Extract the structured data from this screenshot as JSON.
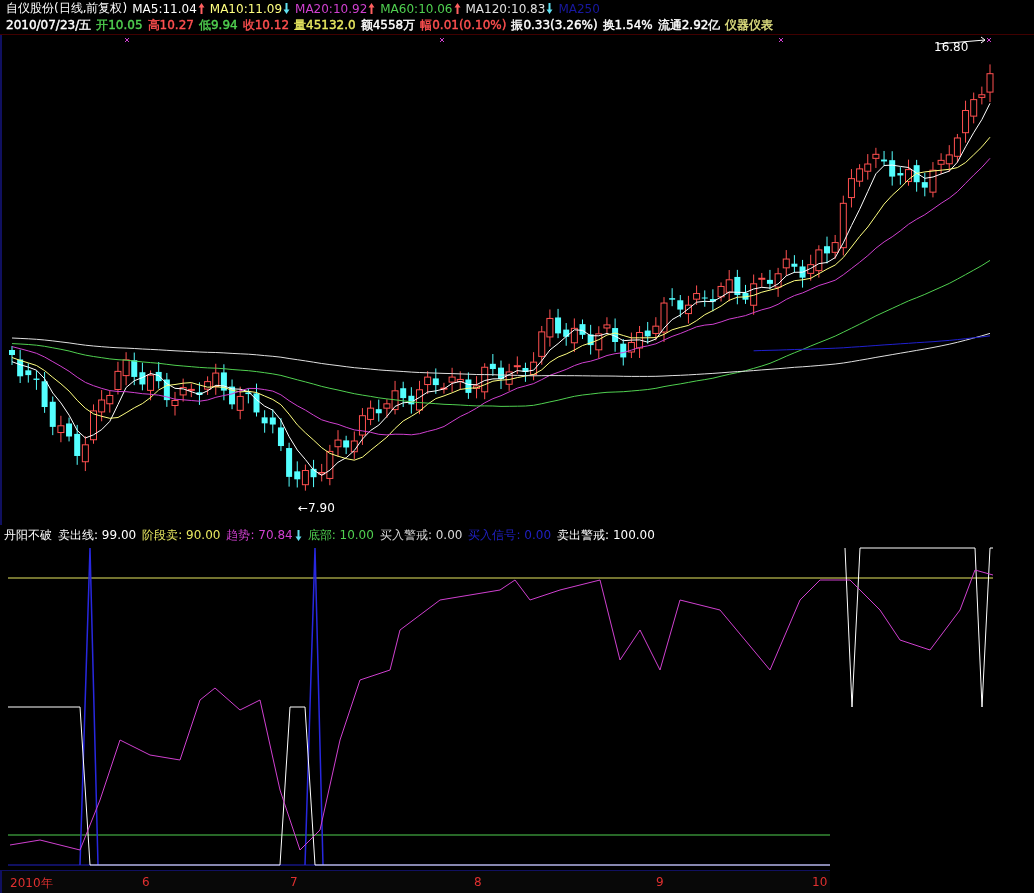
{
  "header": {
    "title": "自仪股份(日线,前复权)",
    "moving_averages": [
      {
        "label": "MA5:",
        "value": "11.04",
        "rising": true,
        "color": "#ffffff"
      },
      {
        "label": "MA10:",
        "value": "11.09",
        "rising": false,
        "color": "#ffff80"
      },
      {
        "label": "MA20:",
        "value": "10.92",
        "rising": true,
        "color": "#d040d0"
      },
      {
        "label": "MA60:",
        "value": "10.06",
        "rising": true,
        "color": "#50d050"
      },
      {
        "label": "MA120:",
        "value": "10.83",
        "rising": false,
        "color": "#e0e0e0"
      },
      {
        "label": "MA250",
        "color": "#1818a0"
      }
    ],
    "quote": [
      {
        "text": "2010/07/23/五",
        "color": "#ffffff"
      },
      {
        "text": "开10.05",
        "color": "#50d050"
      },
      {
        "text": "高10.27",
        "color": "#ff5050"
      },
      {
        "text": "低9.94",
        "color": "#50d050"
      },
      {
        "text": "收10.12",
        "color": "#ff5050"
      },
      {
        "text": "量45132.0",
        "color": "#e8e860"
      },
      {
        "text": "额4558万",
        "color": "#ffffff"
      },
      {
        "text": "幅0.01(0.10%)",
        "color": "#ff5050"
      },
      {
        "text": "振0.33(3.26%)",
        "color": "#ffffff"
      },
      {
        "text": "换1.54%",
        "color": "#ffffff"
      },
      {
        "text": "流通2.92亿",
        "color": "#ffffff"
      },
      {
        "text": "仪器仪表",
        "color": "#e0e080"
      }
    ]
  },
  "price_marks": {
    "high": "16.80",
    "low": "←7.90"
  },
  "indicator": {
    "name": "丹阳不破",
    "items": [
      {
        "label": "卖出线:",
        "value": "99.00",
        "color": "#ffffff"
      },
      {
        "label": "阶段卖:",
        "value": "90.00",
        "color": "#e8e860"
      },
      {
        "label": "趋势:",
        "value": "70.84",
        "rising": false,
        "color": "#d040d0"
      },
      {
        "label": "底部:",
        "value": "10.00",
        "color": "#50d050"
      },
      {
        "label": "买入警戒:",
        "value": "0.00",
        "color": "#d8d8d8"
      },
      {
        "label": "买入信号:",
        "value": "0.00",
        "color": "#2020c0"
      },
      {
        "label": "卖出警戒:",
        "value": "100.00",
        "color": "#ffffff"
      }
    ]
  },
  "x_axis": [
    "2010年",
    "6",
    "7",
    "8",
    "9",
    "10"
  ]
}
